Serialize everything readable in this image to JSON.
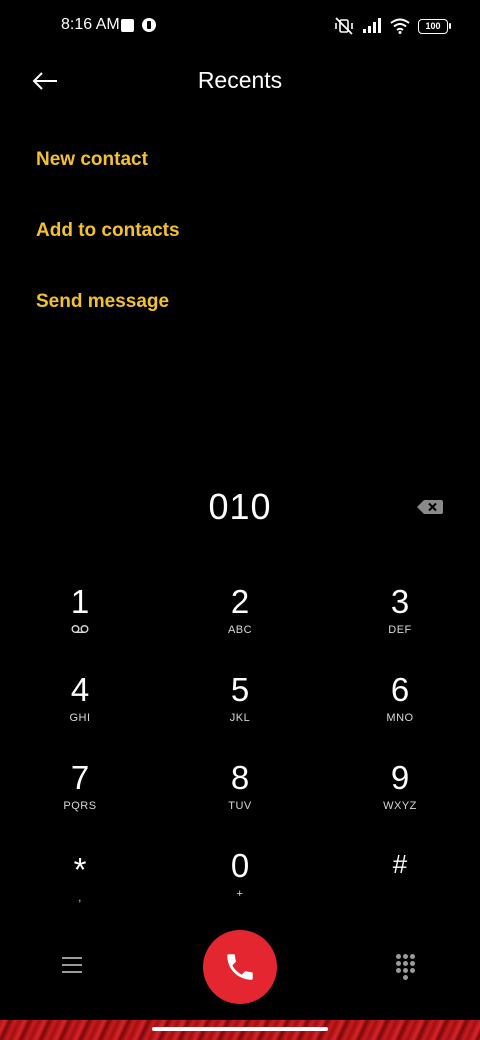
{
  "status_bar": {
    "time": "8:16 AM",
    "battery": "100",
    "icons": [
      "screenshot-icon",
      "app-notification-icon",
      "vibrate-off-icon",
      "signal-icon",
      "wifi-icon",
      "battery-icon"
    ]
  },
  "header": {
    "title": "Recents",
    "back_icon": "arrow-left-icon"
  },
  "actions": {
    "new_contact": "New contact",
    "add_to_contacts": "Add to contacts",
    "send_message": "Send message"
  },
  "dialer": {
    "number": "010",
    "backspace_icon": "backspace-icon"
  },
  "keypad": {
    "k1": {
      "digit": "1",
      "letters": ""
    },
    "k2": {
      "digit": "2",
      "letters": "ABC"
    },
    "k3": {
      "digit": "3",
      "letters": "DEF"
    },
    "k4": {
      "digit": "4",
      "letters": "GHI"
    },
    "k5": {
      "digit": "5",
      "letters": "JKL"
    },
    "k6": {
      "digit": "6",
      "letters": "MNO"
    },
    "k7": {
      "digit": "7",
      "letters": "PQRS"
    },
    "k8": {
      "digit": "8",
      "letters": "TUV"
    },
    "k9": {
      "digit": "9",
      "letters": "WXYZ"
    },
    "kstar": {
      "digit": "*",
      "letters": ","
    },
    "k0": {
      "digit": "0",
      "letters": "+"
    },
    "khash": {
      "digit": "#",
      "letters": ""
    }
  },
  "bottom_bar": {
    "menu_icon": "menu-icon",
    "call_icon": "phone-icon",
    "dialpad_icon": "dialpad-icon"
  },
  "colors": {
    "background": "#000000",
    "accent": "#f2c12e",
    "call_button": "#e3262f",
    "secondary_icon": "#9a9a9a"
  }
}
